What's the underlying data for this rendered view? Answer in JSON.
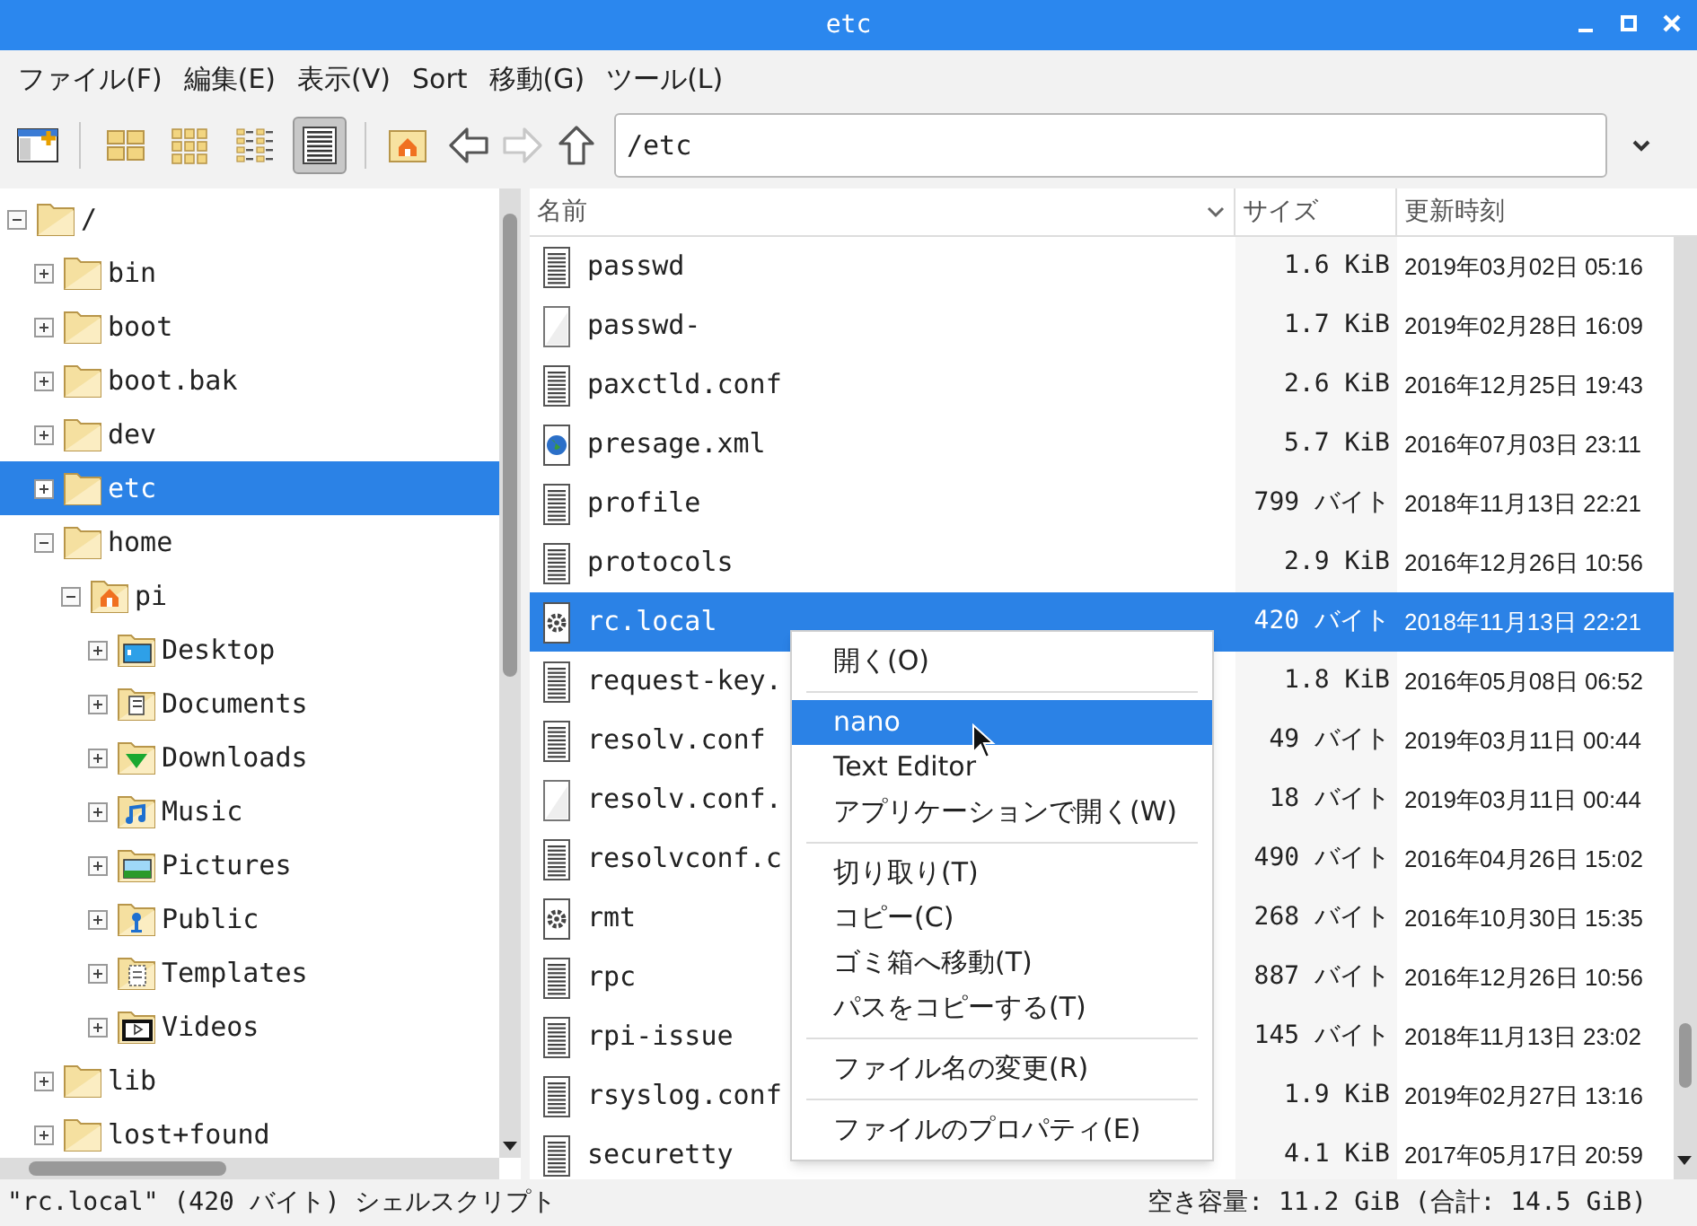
{
  "window": {
    "title": "etc"
  },
  "menu": [
    "ファイル(F)",
    "編集(E)",
    "表示(V)",
    "Sort",
    "移動(G)",
    "ツール(L)"
  ],
  "toolbar": {
    "views": [
      {
        "kind": "icons",
        "selected": false
      },
      {
        "kind": "thumbnails",
        "selected": false
      },
      {
        "kind": "compact",
        "selected": false
      },
      {
        "kind": "list",
        "selected": true
      }
    ],
    "nav": [
      {
        "kind": "back",
        "disabled": false
      },
      {
        "kind": "forward",
        "disabled": true
      },
      {
        "kind": "up",
        "disabled": false
      }
    ],
    "path": "/etc"
  },
  "tree": [
    {
      "label": "/",
      "kind": "folder",
      "expanded": true,
      "selected": false,
      "children": [
        {
          "label": "bin",
          "kind": "folder",
          "expanded": false,
          "selected": false
        },
        {
          "label": "boot",
          "kind": "folder",
          "expanded": false,
          "selected": false
        },
        {
          "label": "boot.bak",
          "kind": "folder",
          "expanded": false,
          "selected": false
        },
        {
          "label": "dev",
          "kind": "folder",
          "expanded": false,
          "selected": false
        },
        {
          "label": "etc",
          "kind": "folder",
          "expanded": false,
          "selected": true
        },
        {
          "label": "home",
          "kind": "folder",
          "expanded": true,
          "selected": false,
          "children": [
            {
              "label": "pi",
              "kind": "home",
              "expanded": true,
              "selected": false,
              "children": [
                {
                  "label": "Desktop",
                  "kind": "desktop",
                  "expanded": false,
                  "selected": false
                },
                {
                  "label": "Documents",
                  "kind": "documents",
                  "expanded": false,
                  "selected": false
                },
                {
                  "label": "Downloads",
                  "kind": "downloads",
                  "expanded": false,
                  "selected": false
                },
                {
                  "label": "Music",
                  "kind": "music",
                  "expanded": false,
                  "selected": false
                },
                {
                  "label": "Pictures",
                  "kind": "pictures",
                  "expanded": false,
                  "selected": false
                },
                {
                  "label": "Public",
                  "kind": "public",
                  "expanded": false,
                  "selected": false
                },
                {
                  "label": "Templates",
                  "kind": "templates",
                  "expanded": false,
                  "selected": false
                },
                {
                  "label": "Videos",
                  "kind": "videos",
                  "expanded": false,
                  "selected": false
                }
              ]
            }
          ]
        },
        {
          "label": "lib",
          "kind": "folder",
          "expanded": false,
          "selected": false
        },
        {
          "label": "lost+found",
          "kind": "folder",
          "expanded": false,
          "selected": false
        }
      ]
    }
  ],
  "table": {
    "columns": [
      "名前",
      "サイズ",
      "更新時刻"
    ],
    "rows": [
      {
        "name": "passwd",
        "kind": "text",
        "size": "1.6 KiB",
        "modified": "2019年03月02日 05:16",
        "selected": false
      },
      {
        "name": "passwd-",
        "kind": "blank",
        "size": "1.7 KiB",
        "modified": "2019年02月28日 16:09",
        "selected": false
      },
      {
        "name": "paxctld.conf",
        "kind": "text",
        "size": "2.6 KiB",
        "modified": "2016年12月25日 19:43",
        "selected": false
      },
      {
        "name": "presage.xml",
        "kind": "xml",
        "size": "5.7 KiB",
        "modified": "2016年07月03日 23:11",
        "selected": false
      },
      {
        "name": "profile",
        "kind": "text",
        "size": "799 バイト",
        "modified": "2018年11月13日 22:21",
        "selected": false
      },
      {
        "name": "protocols",
        "kind": "text",
        "size": "2.9 KiB",
        "modified": "2016年12月26日 10:56",
        "selected": false
      },
      {
        "name": "rc.local",
        "kind": "script",
        "size": "420 バイト",
        "modified": "2018年11月13日 22:21",
        "selected": true
      },
      {
        "name": "request-key.",
        "kind": "text",
        "size": "1.8 KiB",
        "modified": "2016年05月08日 06:52",
        "selected": false
      },
      {
        "name": "resolv.conf",
        "kind": "text",
        "size": "49 バイト",
        "modified": "2019年03月11日 00:44",
        "selected": false
      },
      {
        "name": "resolv.conf.",
        "kind": "blank",
        "size": "18 バイト",
        "modified": "2019年03月11日 00:44",
        "selected": false
      },
      {
        "name": "resolvconf.c",
        "kind": "text",
        "size": "490 バイト",
        "modified": "2016年04月26日 15:02",
        "selected": false
      },
      {
        "name": "rmt",
        "kind": "script",
        "size": "268 バイト",
        "modified": "2016年10月30日 15:35",
        "selected": false
      },
      {
        "name": "rpc",
        "kind": "text",
        "size": "887 バイト",
        "modified": "2016年12月26日 10:56",
        "selected": false
      },
      {
        "name": "rpi-issue",
        "kind": "text",
        "size": "145 バイト",
        "modified": "2018年11月13日 23:02",
        "selected": false
      },
      {
        "name": "rsyslog.conf",
        "kind": "text",
        "size": "1.9 KiB",
        "modified": "2019年02月27日 13:16",
        "selected": false
      },
      {
        "name": "securetty",
        "kind": "text",
        "size": "4.1 KiB",
        "modified": "2017年05月17日 20:59",
        "selected": false
      }
    ]
  },
  "context_menu": [
    {
      "kind": "item",
      "label": "開く(O)",
      "selected": false
    },
    {
      "kind": "separator"
    },
    {
      "kind": "item",
      "label": "nano",
      "selected": true
    },
    {
      "kind": "item",
      "label": "Text Editor",
      "selected": false
    },
    {
      "kind": "item",
      "label": "アプリケーションで開く(W)",
      "selected": false
    },
    {
      "kind": "separator"
    },
    {
      "kind": "item",
      "label": "切り取り(T)",
      "selected": false
    },
    {
      "kind": "item",
      "label": "コピー(C)",
      "selected": false
    },
    {
      "kind": "item",
      "label": "ゴミ箱へ移動(T)",
      "selected": false
    },
    {
      "kind": "item",
      "label": "パスをコピーする(T)",
      "selected": false
    },
    {
      "kind": "separator"
    },
    {
      "kind": "item",
      "label": "ファイル名の変更(R)",
      "selected": false
    },
    {
      "kind": "separator"
    },
    {
      "kind": "item",
      "label": "ファイルのプロパティ(E)",
      "selected": false
    }
  ],
  "status_bar": {
    "left": "\"rc.local\" (420 バイト) シェルスクリプト",
    "right": "空き容量: 11.2 GiB (合計: 14.5 GiB)"
  }
}
